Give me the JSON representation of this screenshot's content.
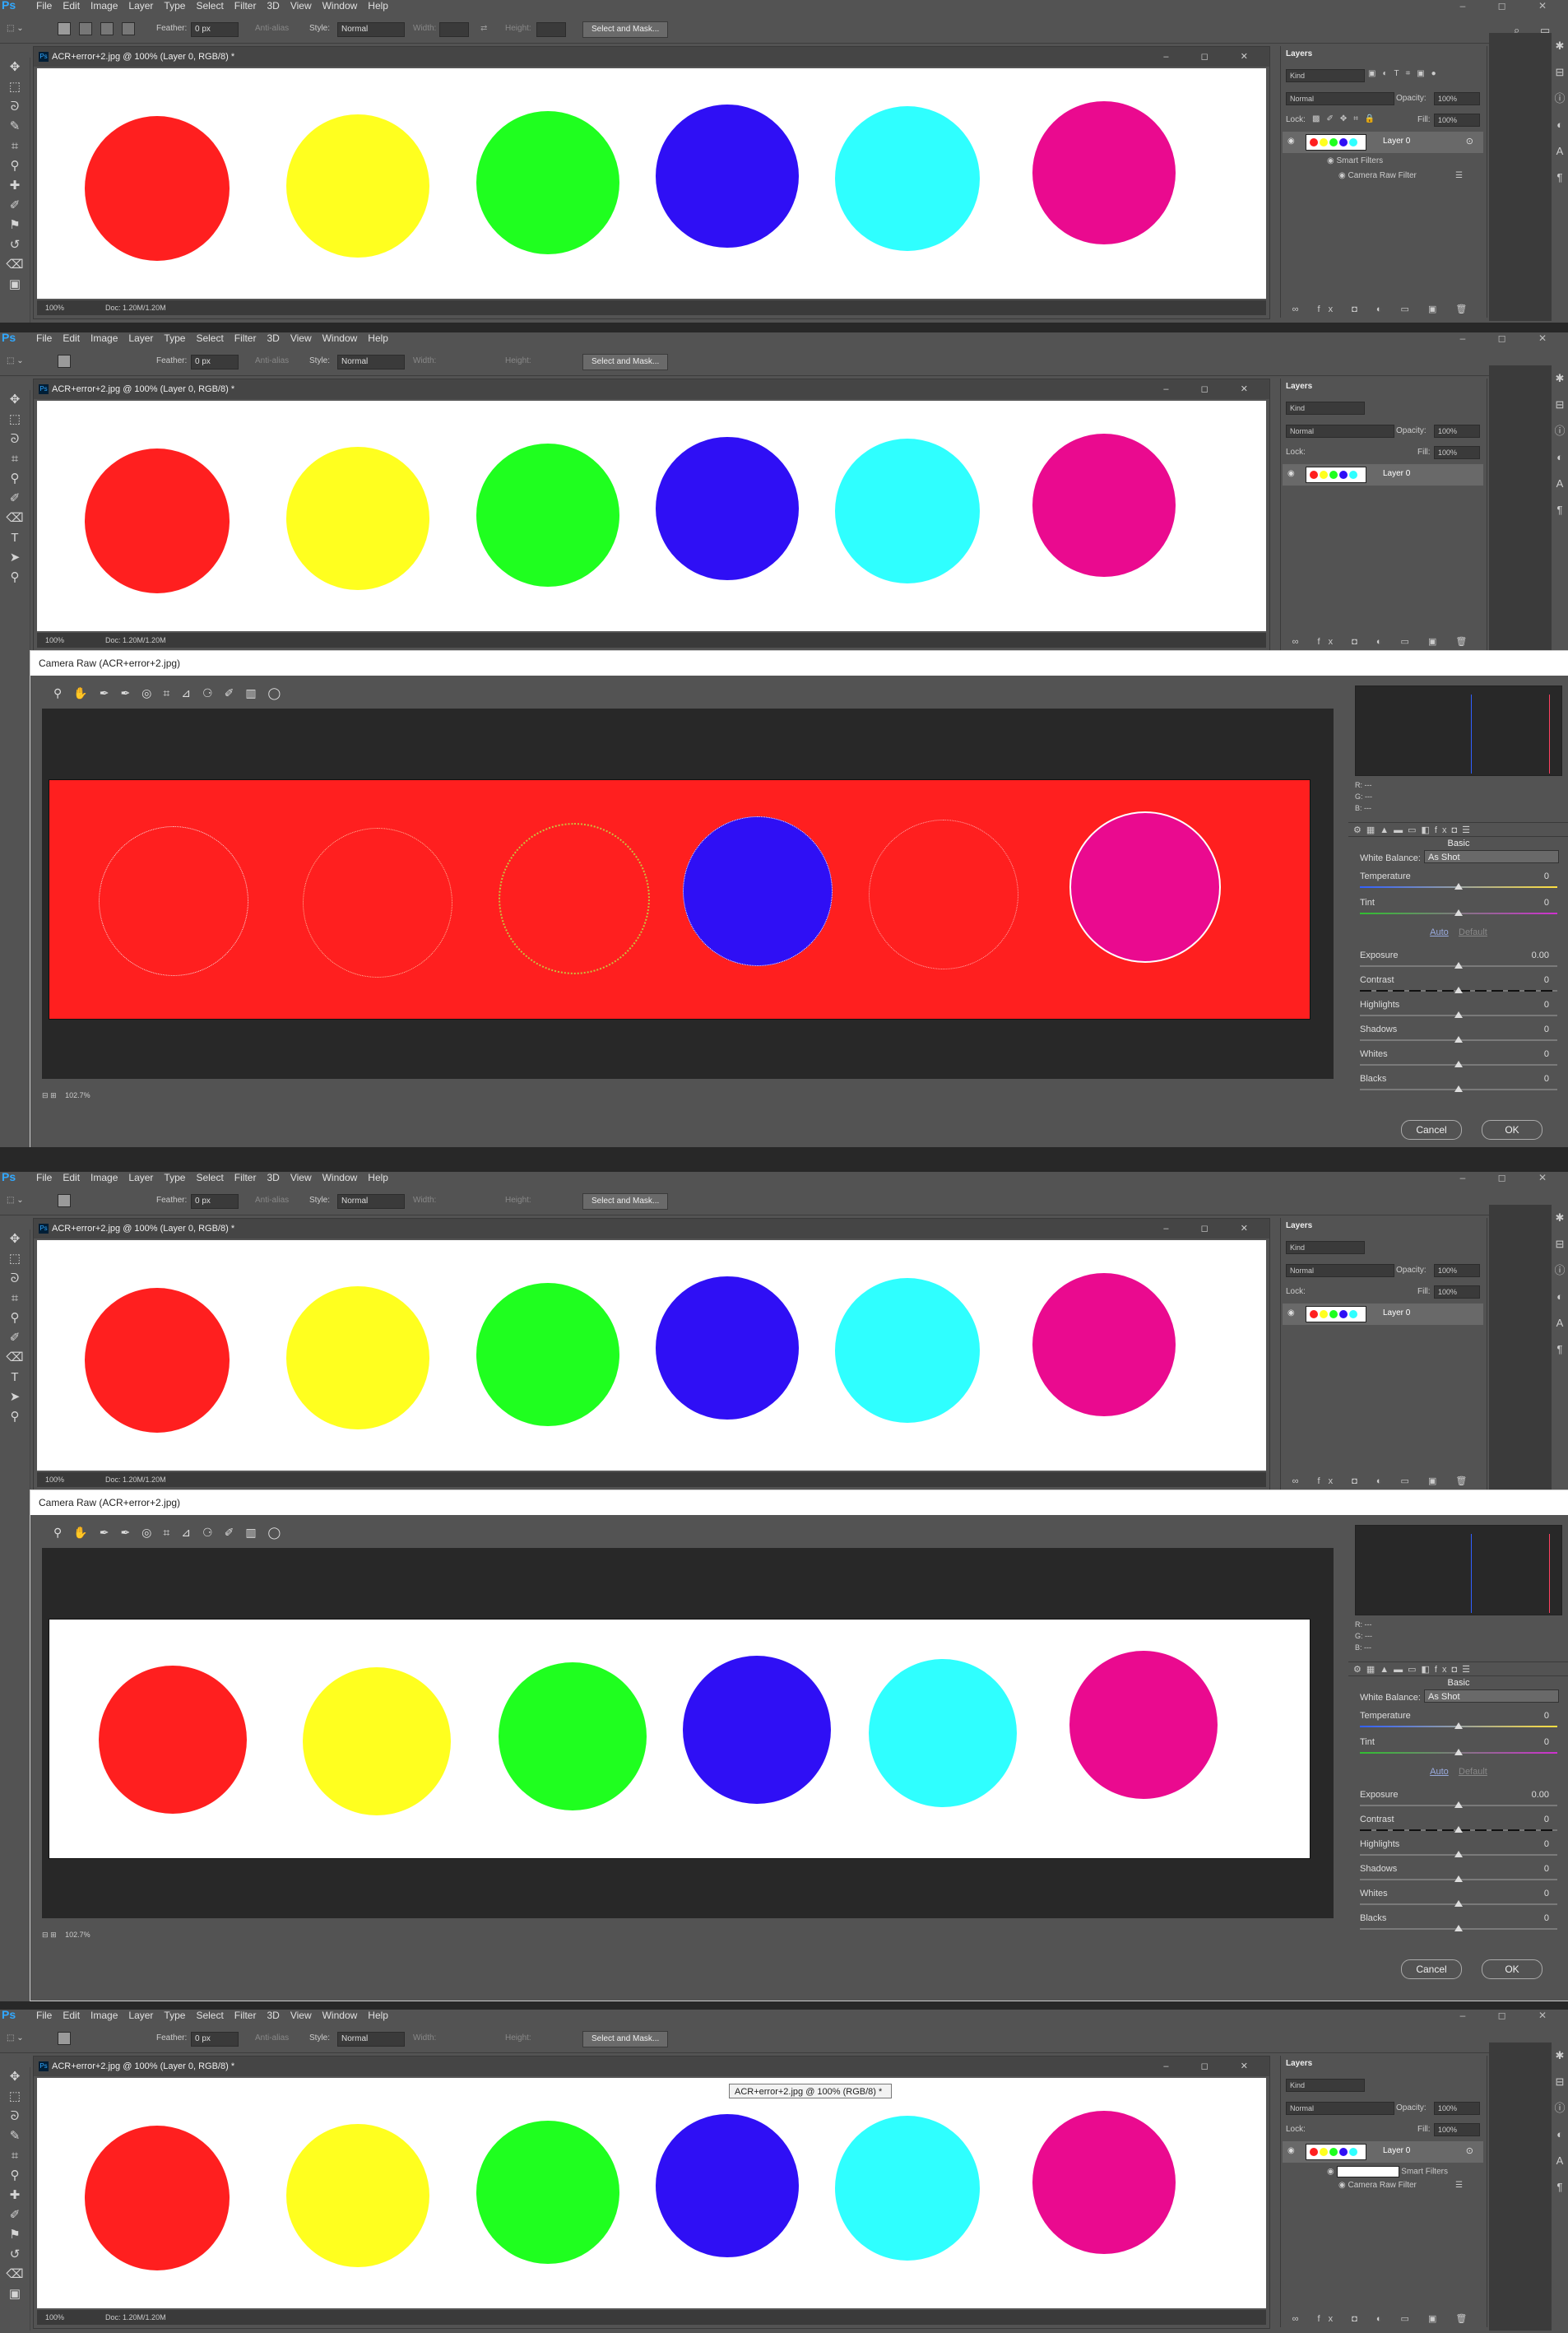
{
  "app": {
    "logo": "Ps",
    "menus": [
      "File",
      "Edit",
      "Image",
      "Layer",
      "Type",
      "Select",
      "Filter",
      "3D",
      "View",
      "Window",
      "Help"
    ],
    "window_controls": "–  ◻  ✕"
  },
  "options_bar": {
    "feather_label": "Feather:",
    "feather_value": "0 px",
    "anti_alias": "Anti-alias",
    "style_label": "Style:",
    "style_value": "Normal",
    "width_label": "Width:",
    "height_label": "Height:",
    "select_mask": "Select and Mask..."
  },
  "document": {
    "tab_title": "ACR+error+2.jpg @ 100% (Layer 0, RGB/8) *",
    "zoom": "100%",
    "doc_size": "Doc: 1.20M/1.20M",
    "circle_colors": [
      "#ff1f1f",
      "#ffff1f",
      "#1fff1f",
      "#2f0ff5",
      "#2fffff",
      "#ea0a8f"
    ]
  },
  "layers_panel": {
    "title": "Layers",
    "kind": "Kind",
    "blend_mode": "Normal",
    "opacity_label": "Opacity:",
    "opacity_value": "100%",
    "lock_label": "Lock:",
    "fill_label": "Fill:",
    "fill_value": "100%",
    "layer_name": "Layer 0",
    "smart_filters": "Smart Filters",
    "camera_raw_filter": "Camera Raw Filter",
    "bottom_icons": "∞ fx ◘ ◐ ▭ ▣ 🗑"
  },
  "camera_raw": {
    "title": "Camera Raw (ACR+error+2.jpg)",
    "zoom": "102.7%",
    "r": "R:",
    "g": "G:",
    "b": "B:",
    "dashes": "---",
    "panel": "Basic",
    "white_balance_label": "White Balance:",
    "white_balance_value": "As Shot",
    "auto": "Auto",
    "default": "Default",
    "sliders": [
      {
        "label": "Temperature",
        "value": "0"
      },
      {
        "label": "Tint",
        "value": "0"
      },
      {
        "label": "Exposure",
        "value": "0.00"
      },
      {
        "label": "Contrast",
        "value": "0"
      },
      {
        "label": "Highlights",
        "value": "0"
      },
      {
        "label": "Shadows",
        "value": "0"
      },
      {
        "label": "Whites",
        "value": "0"
      },
      {
        "label": "Blacks",
        "value": "0"
      }
    ],
    "cancel": "Cancel",
    "ok": "OK",
    "error_colors": [
      "#ff1f1f",
      "#ff1f1f",
      "#ff1f1f",
      "#2f0ff5",
      "#ff1f1f",
      "#ea0a8f"
    ]
  },
  "tooltip": "ACR+error+2.jpg @ 100% (RGB/8) *"
}
